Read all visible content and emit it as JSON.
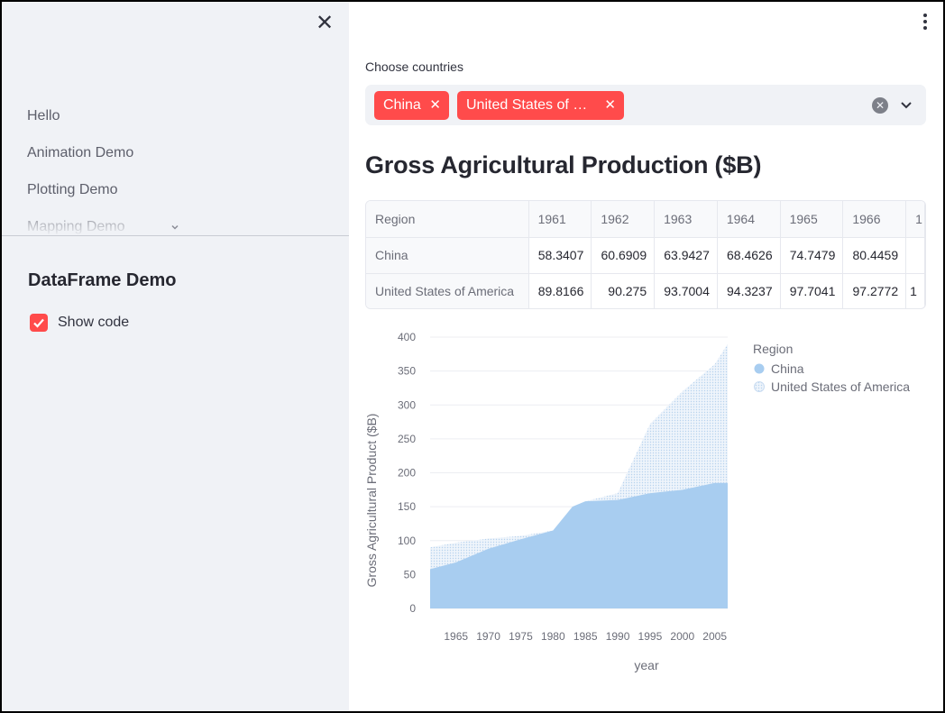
{
  "sidebar": {
    "close_label": "✕",
    "nav_items": [
      "Hello",
      "Animation Demo",
      "Plotting Demo",
      "Mapping Demo"
    ],
    "page_heading": "DataFrame Demo",
    "show_code": {
      "label": "Show code",
      "checked": true
    }
  },
  "main": {
    "select_label": "Choose countries",
    "selected": [
      "China",
      "United States of …"
    ],
    "title": "Gross Agricultural Production ($B)",
    "table": {
      "columns": [
        "Region",
        "1961",
        "1962",
        "1963",
        "1964",
        "1965",
        "1966",
        "1"
      ],
      "rows": [
        [
          "China",
          "58.3407",
          "60.6909",
          "63.9427",
          "68.4626",
          "74.7479",
          "80.4459",
          ""
        ],
        [
          "United States of America",
          "89.8166",
          "90.275",
          "93.7004",
          "94.3237",
          "97.7041",
          "97.2772",
          "1"
        ]
      ]
    }
  },
  "colors": {
    "accent": "#ff4b4b",
    "china": "#a8cdf0",
    "usa": "#dce9f7"
  },
  "chart_data": {
    "type": "area",
    "stacked": true,
    "xlabel": "year",
    "ylabel": "Gross Agricultural Product ($B)",
    "ylim": [
      0,
      400
    ],
    "xlim": [
      1961,
      2007
    ],
    "yticks": [
      0,
      50,
      100,
      150,
      200,
      250,
      300,
      350,
      400
    ],
    "xticks": [
      1965,
      1970,
      1975,
      1980,
      1985,
      1990,
      1995,
      2000,
      2005
    ],
    "legend_title": "Region",
    "legend_position": "right",
    "x": [
      1961,
      1965,
      1970,
      1975,
      1980,
      1983,
      1985,
      1990,
      1995,
      2000,
      2005,
      2007
    ],
    "series": [
      {
        "name": "China",
        "values": [
          58,
          68,
          88,
          102,
          115,
          150,
          158,
          160,
          170,
          175,
          185,
          185
        ]
      },
      {
        "name": "United States of America",
        "values": [
          90,
          97,
          103,
          107,
          113,
          128,
          138,
          170,
          272,
          320,
          360,
          390
        ]
      }
    ]
  }
}
